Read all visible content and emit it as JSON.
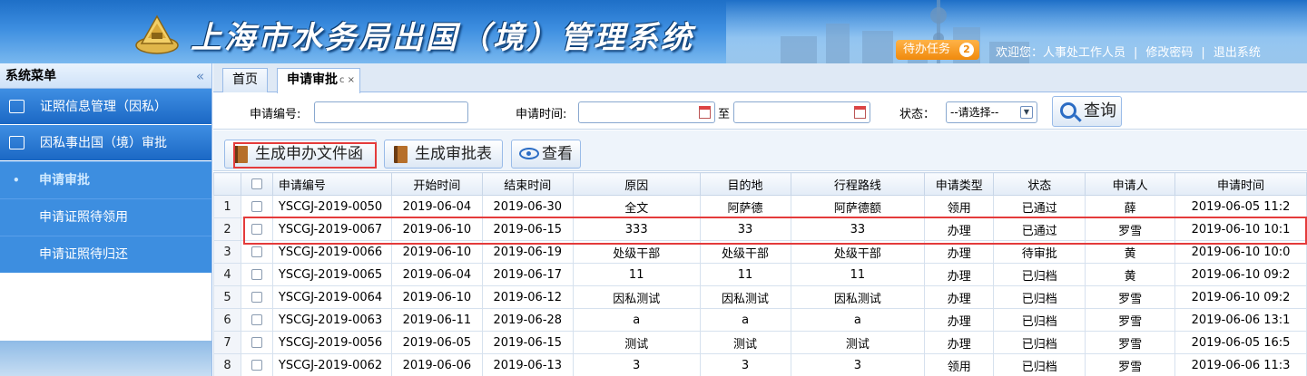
{
  "header": {
    "title": "上海市水务局出国（境）管理系统",
    "todo_label": "待办任务",
    "todo_count": "2",
    "welcome": "欢迎您：人事处工作人员",
    "change_password": "修改密码",
    "logout": "退出系统",
    "separator": "|",
    "logo_icon": "seal-logo-icon"
  },
  "sidebar": {
    "title": "系统菜单",
    "collapse": "«",
    "groups": [
      {
        "label": "证照信息管理（因私）",
        "icon": "image-icon"
      },
      {
        "label": "因私事出国（境）审批",
        "icon": "edit-icon"
      }
    ],
    "items": [
      {
        "label": "申请审批",
        "active": true
      },
      {
        "label": "申请证照待领用"
      },
      {
        "label": "申请证照待归还"
      }
    ],
    "bullet": "•"
  },
  "tabs": [
    {
      "label": "首页"
    },
    {
      "label": "申请审批",
      "active": true,
      "tools": "c ×"
    }
  ],
  "search": {
    "app_no_label": "申请编号:",
    "app_no_value": "",
    "time_label": "申请时间:",
    "time_from": "",
    "to_label": "至",
    "time_to": "",
    "status_label": "状态：",
    "status_value": "--请选择--",
    "query_button": "查询"
  },
  "toolbar": {
    "generate_letter": "生成申办文件函",
    "generate_form": "生成审批表",
    "view": "查看"
  },
  "grid": {
    "columns": [
      "申请编号",
      "开始时间",
      "结束时间",
      "原因",
      "目的地",
      "行程路线",
      "申请类型",
      "状态",
      "申请人",
      "申请时间"
    ],
    "rows": [
      {
        "n": "1",
        "id": "YSCGJ-2019-0050",
        "start": "2019-06-04",
        "end": "2019-06-30",
        "reason": "全文",
        "dest": "阿萨德",
        "route": "阿萨德额",
        "type": "领用",
        "status": "已通过",
        "applicant": "薛",
        "time": "2019-06-05 11:2"
      },
      {
        "n": "2",
        "id": "YSCGJ-2019-0067",
        "start": "2019-06-10",
        "end": "2019-06-15",
        "reason": "333",
        "dest": "33",
        "route": "33",
        "type": "办理",
        "status": "已通过",
        "applicant": "罗雪",
        "time": "2019-06-10 10:1"
      },
      {
        "n": "3",
        "id": "YSCGJ-2019-0066",
        "start": "2019-06-10",
        "end": "2019-06-19",
        "reason": "处级干部",
        "dest": "处级干部",
        "route": "处级干部",
        "type": "办理",
        "status": "待审批",
        "applicant": "黄",
        "time": "2019-06-10 10:0"
      },
      {
        "n": "4",
        "id": "YSCGJ-2019-0065",
        "start": "2019-06-04",
        "end": "2019-06-17",
        "reason": "11",
        "dest": "11",
        "route": "11",
        "type": "办理",
        "status": "已归档",
        "applicant": "黄",
        "time": "2019-06-10 09:2"
      },
      {
        "n": "5",
        "id": "YSCGJ-2019-0064",
        "start": "2019-06-10",
        "end": "2019-06-12",
        "reason": "因私测试",
        "dest": "因私测试",
        "route": "因私测试",
        "type": "办理",
        "status": "已归档",
        "applicant": "罗雪",
        "time": "2019-06-10 09:2"
      },
      {
        "n": "6",
        "id": "YSCGJ-2019-0063",
        "start": "2019-06-11",
        "end": "2019-06-28",
        "reason": "a",
        "dest": "a",
        "route": "a",
        "type": "办理",
        "status": "已归档",
        "applicant": "罗雪",
        "time": "2019-06-06 13:1"
      },
      {
        "n": "7",
        "id": "YSCGJ-2019-0056",
        "start": "2019-06-05",
        "end": "2019-06-15",
        "reason": "测试",
        "dest": "测试",
        "route": "测试",
        "type": "办理",
        "status": "已归档",
        "applicant": "罗雪",
        "time": "2019-06-05 16:5"
      },
      {
        "n": "8",
        "id": "YSCGJ-2019-0062",
        "start": "2019-06-06",
        "end": "2019-06-13",
        "reason": "3",
        "dest": "3",
        "route": "3",
        "type": "领用",
        "status": "已归档",
        "applicant": "罗雪",
        "time": "2019-06-06 11:3"
      }
    ]
  },
  "colors": {
    "accent": "#2b6cc4",
    "highlight": "#e43b3b",
    "todo": "#f08a0c"
  }
}
